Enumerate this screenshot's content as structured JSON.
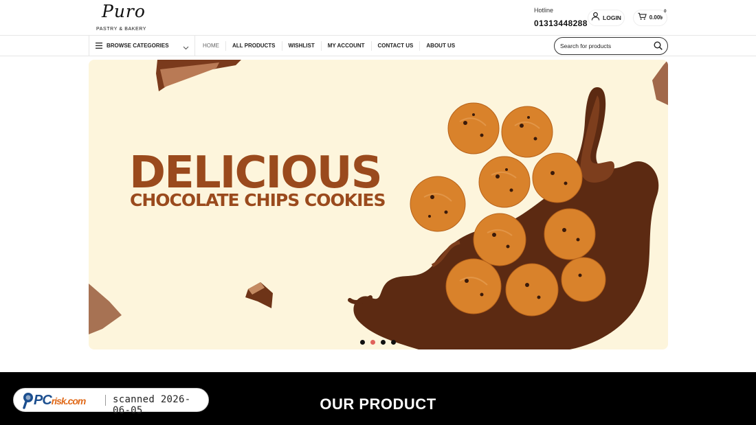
{
  "header": {
    "logo": {
      "script": "Puro",
      "tagline": "PASTRY & BAKERY"
    },
    "hotline_label": "Hotline",
    "hotline_number": "01313448288",
    "login_label": "LOGIN",
    "cart_total": "0.00৳",
    "cart_count": "0"
  },
  "nav": {
    "browse_label": "BROWSE CATEGORIES",
    "items": [
      {
        "label": "HOME",
        "active": true
      },
      {
        "label": "ALL PRODUCTS"
      },
      {
        "label": "WISHLIST"
      },
      {
        "label": "MY ACCOUNT"
      },
      {
        "label": "CONTACT US"
      },
      {
        "label": "ABOUT US"
      }
    ],
    "search_placeholder": "Search for products"
  },
  "hero": {
    "headline": "DELICIOUS",
    "subheadline": "CHOCOLATE CHIPS COOKIES",
    "slide_count": 4,
    "active_slide": 2
  },
  "section": {
    "title": "OUR PRODUCT"
  },
  "badge": {
    "brand_main": "PC",
    "brand_sub": "risk.com",
    "text": "scanned 2026-06-05"
  },
  "colors": {
    "hero_bg": "#fdf5dc",
    "headline": "#9a4a1d",
    "chocolate": "#5c2a12",
    "cookie": "#d9822b",
    "active_dot": "#e0625b"
  }
}
